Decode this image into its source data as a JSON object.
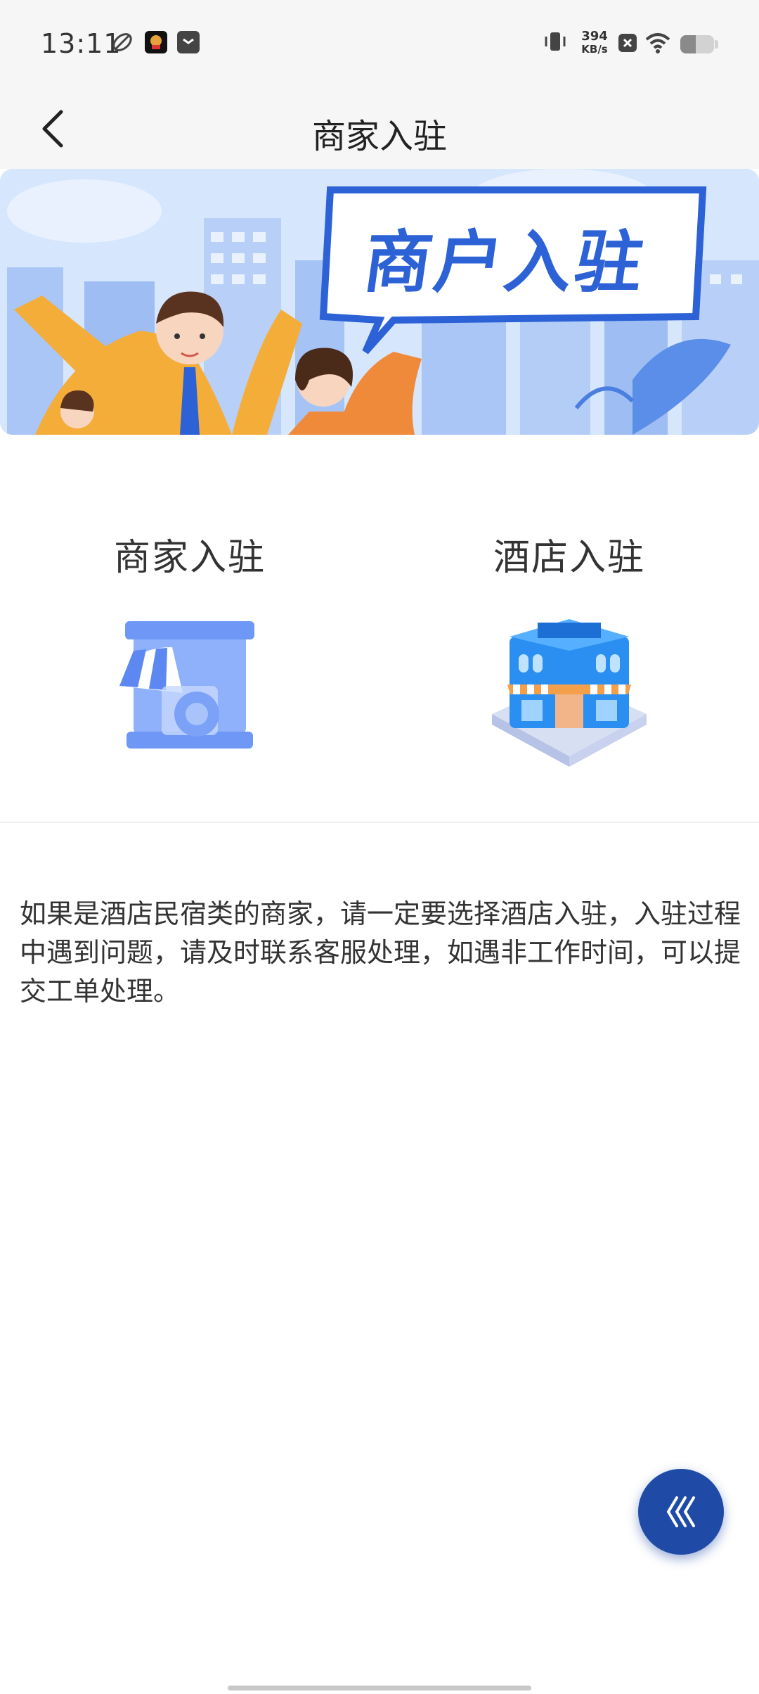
{
  "status_bar": {
    "time": "13:11",
    "net_speed_value": "394",
    "net_speed_unit": "KB/s",
    "battery_level": 0.45,
    "icons": [
      "leaf-icon",
      "app-icon",
      "message-icon",
      "vibrate-icon",
      "close-box-icon",
      "wifi-icon",
      "battery-icon"
    ]
  },
  "header": {
    "title": "商家入驻",
    "back_icon": "chevron-left-icon"
  },
  "banner": {
    "text": "商户入驻"
  },
  "options": [
    {
      "label": "商家入驻",
      "icon": "shop-icon"
    },
    {
      "label": "酒店入驻",
      "icon": "hotel-icon"
    }
  ],
  "note": "如果是酒店民宿类的商家，请一定要选择酒店入驻，入驻过程中遇到问题，请及时联系客服处理，如遇非工作时间，可以提交工单处理。",
  "fab": {
    "icon": "chevrons-left-icon"
  },
  "colors": {
    "accent": "#1f4aa5",
    "banner_blue": "#2c62d6",
    "background": "#ffffff",
    "header_bg": "#f6f6f6"
  }
}
